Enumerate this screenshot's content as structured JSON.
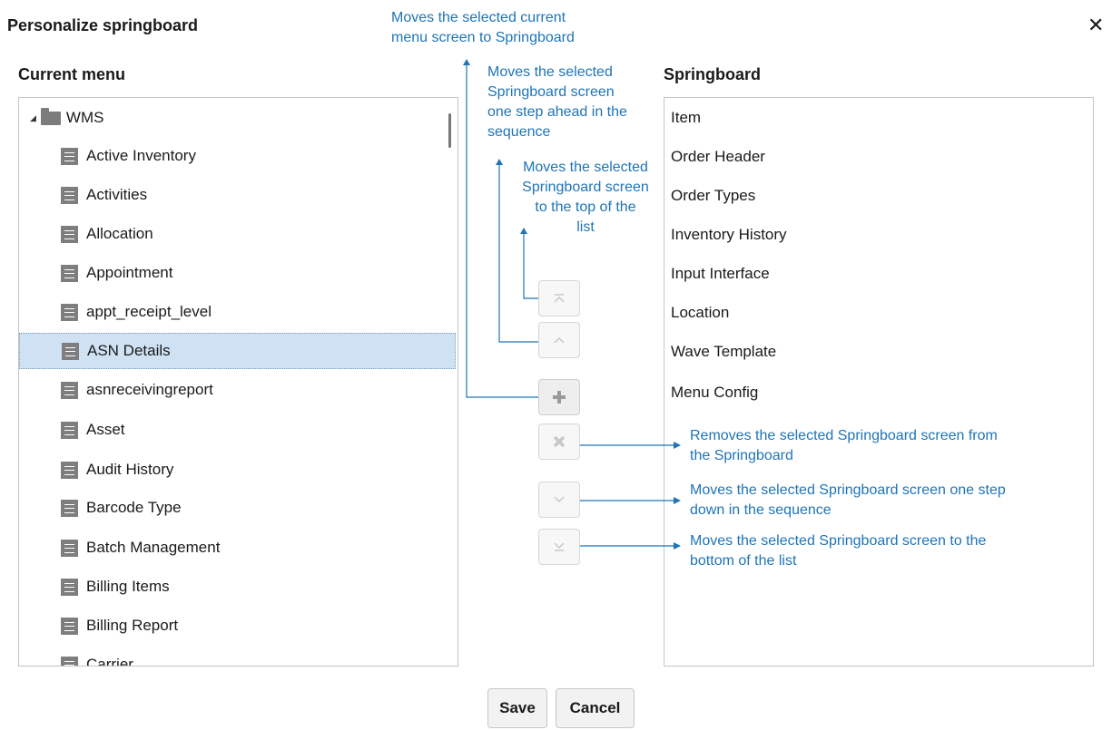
{
  "dialog": {
    "title": "Personalize springboard",
    "close_glyph": "✕"
  },
  "current_menu": {
    "title": "Current menu",
    "root": "WMS",
    "items": [
      "Active Inventory",
      "Activities",
      "Allocation",
      "Appointment",
      "appt_receipt_level",
      "ASN Details",
      "asnreceivingreport",
      "Asset",
      "Audit History",
      "Barcode Type",
      "Batch Management",
      "Billing Items",
      "Billing Report",
      "Carrier"
    ],
    "selected": "ASN Details"
  },
  "springboard": {
    "title": "Springboard",
    "items": [
      "Item",
      "Order Header",
      "Order Types",
      "Inventory History",
      "Input Interface",
      "Location",
      "Wave Template",
      "Menu Config"
    ]
  },
  "controls": {
    "move_top_icon": "move-to-top-icon",
    "move_up_icon": "chevron-up-icon",
    "add_icon": "plus-icon",
    "remove_icon": "x-icon",
    "move_down_icon": "chevron-down-icon",
    "move_bottom_icon": "move-to-bottom-icon"
  },
  "annotations": {
    "add_line1": "Moves the selected current",
    "add_line2": "menu screen to Springboard",
    "up_line1": "Moves the selected",
    "up_line2": "Springboard screen",
    "up_line3": "one step ahead in the",
    "up_line4": "sequence",
    "top_line1": "Moves the selected",
    "top_line2": "Springboard screen",
    "top_line3": "to the top of the",
    "top_line4": "list",
    "remove_line1": "Removes  the selected Springboard screen from",
    "remove_line2": "the Springboard",
    "down_line1": "Moves the selected Springboard screen one step",
    "down_line2": "down in the sequence",
    "bottom_line1": "Moves the selected Springboard screen to the",
    "bottom_line2": "bottom of the list"
  },
  "footer": {
    "save_label": "Save",
    "cancel_label": "Cancel"
  },
  "colors": {
    "annotation": "#1e74b6",
    "selected_row": "#cfe2f3",
    "icon_gray": "#7e7e7e"
  }
}
